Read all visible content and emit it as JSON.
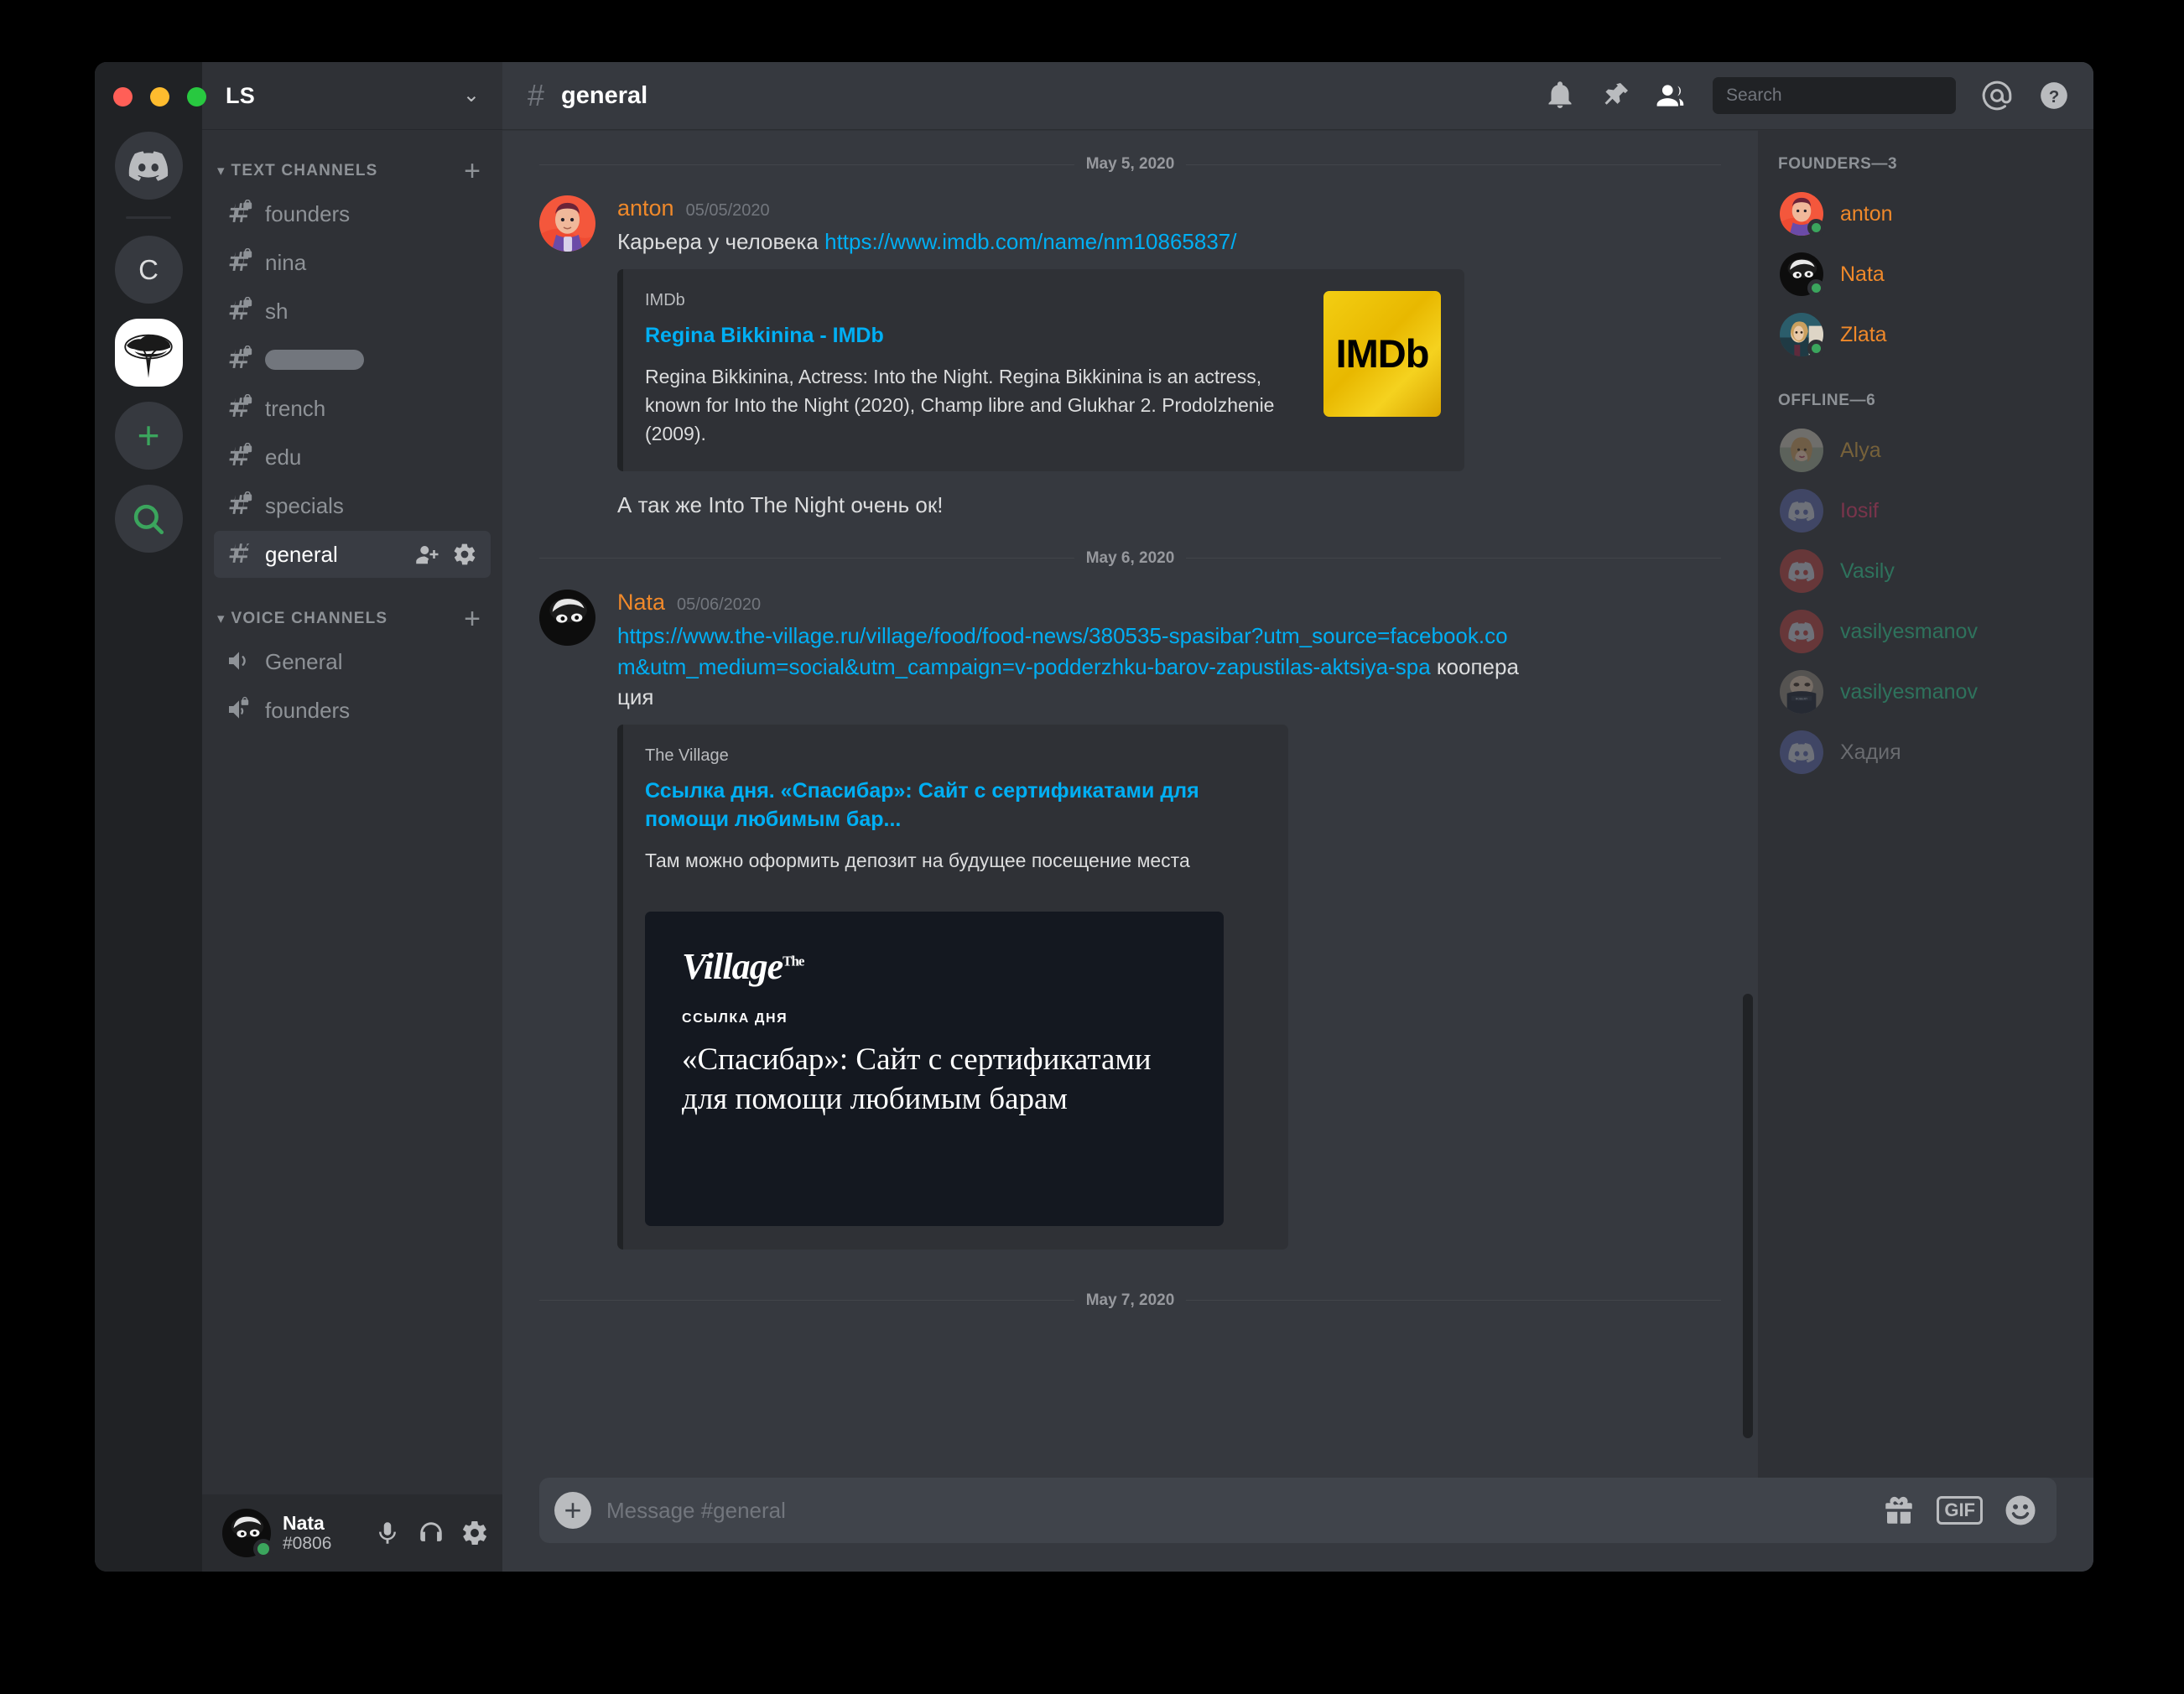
{
  "window": {
    "traffic_lights": [
      "close",
      "minimize",
      "maximize"
    ]
  },
  "server_rail": {
    "servers": [
      {
        "name": "home-discord",
        "type": "logo",
        "label": ""
      },
      {
        "name": "server-c",
        "type": "letter",
        "label": "C"
      },
      {
        "name": "server-tree",
        "type": "image",
        "label": "",
        "active": true
      },
      {
        "name": "add-server",
        "type": "action",
        "label": "+"
      },
      {
        "name": "explore-servers",
        "type": "action",
        "label": "search"
      }
    ]
  },
  "guild": {
    "name": "LS",
    "dropdown_icon": "chevron-down-icon"
  },
  "sidebar": {
    "categories": [
      {
        "label": "TEXT CHANNELS",
        "add_label": "+",
        "channels": [
          {
            "name": "founders",
            "private": true,
            "active": false,
            "redacted": false
          },
          {
            "name": "nina",
            "private": true,
            "active": false,
            "redacted": false
          },
          {
            "name": "sh",
            "private": true,
            "active": false,
            "redacted": false
          },
          {
            "name": "",
            "private": true,
            "active": false,
            "redacted": true
          },
          {
            "name": "trench",
            "private": true,
            "active": false,
            "redacted": false
          },
          {
            "name": "edu",
            "private": true,
            "active": false,
            "redacted": false
          },
          {
            "name": "specials",
            "private": true,
            "active": false,
            "redacted": false
          },
          {
            "name": "general",
            "private": false,
            "active": true,
            "redacted": false
          }
        ]
      },
      {
        "label": "VOICE CHANNELS",
        "add_label": "+",
        "channels": [
          {
            "name": "General",
            "private": false,
            "active": false,
            "redacted": false
          },
          {
            "name": "founders",
            "private": true,
            "active": false,
            "redacted": false
          }
        ]
      }
    ]
  },
  "user_panel": {
    "name": "Nata",
    "tag": "#0806",
    "status": "online",
    "actions": [
      "microphone-icon",
      "headphones-icon",
      "settings-gear-icon"
    ]
  },
  "top_bar": {
    "hash": "#",
    "channel": "general",
    "icons": [
      "bell-icon",
      "pin-icon",
      "members-icon",
      "mention-icon",
      "help-icon"
    ]
  },
  "search": {
    "placeholder": "Search",
    "value": "",
    "icon": "search-icon"
  },
  "messages": [
    {
      "divider": "May 5, 2020",
      "author": "anton",
      "author_color": "#f0892a",
      "timestamp": "05/05/2020",
      "text_before": "Карьера у человека ",
      "link": "https://www.imdb.com/name/nm10865837/",
      "embed": {
        "provider": "IMDb",
        "title": "Regina Bikkinina - IMDb",
        "description": "Regina Bikkinina, Actress: Into the Night. Regina Bikkinina is an actress, known for Into the Night (2020), Champ libre and Glukhar 2. Prodolzhenie (2009).",
        "thumb_text": "IMDb"
      },
      "followup": "А так же Into The Night очень ок!"
    },
    {
      "divider": "May 6, 2020",
      "author": "Nata",
      "author_color": "#f0892a",
      "timestamp": "05/06/2020",
      "link": "https://www.the-village.ru/village/food/food-news/380535-spasibar?utm_source=facebook.com&utm_medium=social&utm_campaign=v-podderzhku-barov-zapustilas-aktsiya-spa",
      "text_after": " кооперация",
      "embed": {
        "provider": "The Village",
        "title": "Ссылка дня. «Спасибар»: Сайт с сертификатами для помощи любимым бар...",
        "description": "Там можно оформить депозит на будущее посещение места",
        "image": {
          "logo": "Village",
          "logo_sup": "The",
          "kicker": "ССЫЛКА ДНЯ",
          "headline": "«Спасибар»: Сайт с сертификатами для помощи любимым барам"
        }
      }
    }
  ],
  "last_divider": "May 7, 2020",
  "composer": {
    "placeholder": "Message #general",
    "value": "",
    "add_label": "+",
    "gif_label": "GIF",
    "icons": [
      "gift-icon",
      "gif-icon",
      "emoji-icon"
    ]
  },
  "members": {
    "groups": [
      {
        "title": "FOUNDERS—3",
        "members": [
          {
            "name": "anton",
            "color": "#f0892a",
            "online": true,
            "avatar": "anton"
          },
          {
            "name": "Nata",
            "color": "#f0892a",
            "online": true,
            "avatar": "nata"
          },
          {
            "name": "Zlata",
            "color": "#f0892a",
            "online": true,
            "avatar": "zlata"
          }
        ]
      },
      {
        "title": "OFFLINE—6",
        "members": [
          {
            "name": "Alya",
            "color": "#d9a441",
            "online": false,
            "avatar": "alya"
          },
          {
            "name": "Iosif",
            "color": "#e03a6a",
            "online": false,
            "avatar": "discord-blue"
          },
          {
            "name": "Vasily",
            "color": "#2ecc91",
            "online": false,
            "avatar": "discord-red"
          },
          {
            "name": "vasilyesmanov",
            "color": "#2ecc91",
            "online": false,
            "avatar": "discord-red"
          },
          {
            "name": "vasilyesmanov",
            "color": "#2ecc91",
            "online": false,
            "avatar": "mask"
          },
          {
            "name": "Хадия",
            "color": "#b9bbbe",
            "online": false,
            "avatar": "discord-blue"
          }
        ]
      }
    ]
  },
  "colors": {
    "accent_link": "#00aff4",
    "author": "#f0892a",
    "online": "#3ba55d",
    "bg_main": "#36393f",
    "bg_sidebar": "#2f3136",
    "bg_rail": "#202225"
  }
}
